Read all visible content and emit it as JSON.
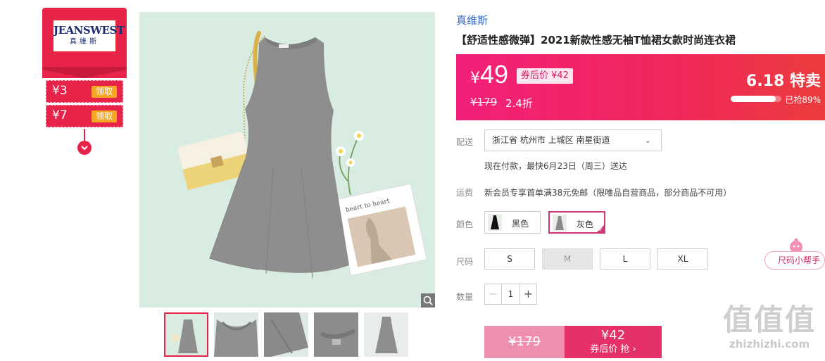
{
  "brand": {
    "logo_en": "JEANSWEST",
    "logo_cn": "真維斯",
    "link_text": "真维斯"
  },
  "coupons": [
    {
      "amount": "¥3",
      "button": "领取"
    },
    {
      "amount": "¥7",
      "button": "领取"
    }
  ],
  "coupon_toggle_icon": "chevron-down-icon",
  "gallery": {
    "thumb_count": 5,
    "zoom_icon": "magnifier-icon",
    "photo_card_text": "heart to heart"
  },
  "product": {
    "title": "【舒适性感微弹】2021新款性感无袖T恤裙女款时尚连衣裙",
    "price_symbol": "¥",
    "price": "49",
    "after_coupon_tag": "券后价 ¥42",
    "original_price": "¥179",
    "discount": "2.4折"
  },
  "promo": {
    "title": "6.18 特卖",
    "sold_label": "已抢89%",
    "sold_fraction": 0.89,
    "banner_colors": [
      "#f2207a",
      "#ec3c3c"
    ]
  },
  "delivery": {
    "label": "配送",
    "address": "浙江省 杭州市 上城区 南星街道",
    "note": "现在付款，最快6月23日（周三）送达"
  },
  "shipping": {
    "label": "运费",
    "note": "新会员专享首单满38元免邮（限唯品自营商品，部分商品不可用）"
  },
  "color": {
    "label": "颜色",
    "options": [
      {
        "name": "黑色",
        "selected": false
      },
      {
        "name": "灰色",
        "selected": true
      }
    ]
  },
  "size": {
    "label": "尺码",
    "options": [
      "S",
      "M",
      "L",
      "XL"
    ],
    "disabled": [
      "M"
    ],
    "helper": "尺码小帮手"
  },
  "quantity": {
    "label": "数量",
    "value": "1",
    "minus": "−",
    "plus": "+"
  },
  "buy": {
    "original_price": "¥179",
    "coupon_price": "¥42",
    "coupon_action": "券后价 抢 ›"
  },
  "watermark": {
    "glyphs": "值值值",
    "url": "zhizhizhi.com"
  },
  "colors": {
    "accent": "#e8234a",
    "link": "#3466c2",
    "select": "#d0357a"
  }
}
